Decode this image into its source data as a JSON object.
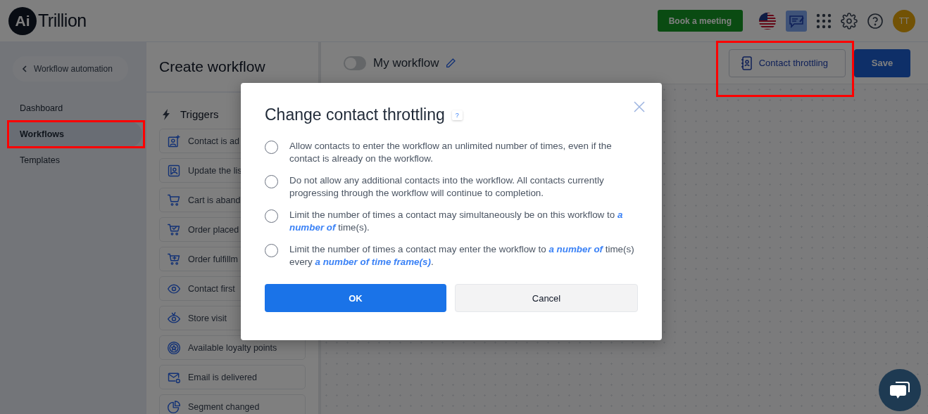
{
  "header": {
    "logo_mark": "Ai",
    "logo_text": "Trillion",
    "book_button": "Book a meeting",
    "avatar": "TT"
  },
  "sidebar": {
    "back_link": "Workflow automation",
    "items": [
      {
        "label": "Dashboard",
        "selected": false,
        "highlighted": false
      },
      {
        "label": "Workflows",
        "selected": true,
        "highlighted": true
      },
      {
        "label": "Templates",
        "selected": false,
        "highlighted": false
      }
    ]
  },
  "panel": {
    "title": "Create workflow",
    "section": "Triggers",
    "triggers": [
      {
        "label": "Contact is ad",
        "kind": "contact"
      },
      {
        "label": "Update the lis",
        "kind": "list"
      },
      {
        "label": "Cart is aband",
        "kind": "cart"
      },
      {
        "label": "Order placed",
        "kind": "order"
      },
      {
        "label": "Order fulfillm",
        "kind": "fulfillment"
      },
      {
        "label": "Contact first",
        "kind": "view"
      },
      {
        "label": "Store visit",
        "kind": "visit"
      },
      {
        "label": "Available loyalty points",
        "kind": "loyalty"
      },
      {
        "label": "Email is delivered",
        "kind": "email"
      },
      {
        "label": "Segment changed",
        "kind": "segment"
      }
    ]
  },
  "canvas": {
    "workflow_on": false,
    "workflow_name": "My workflow",
    "throttling_button": {
      "label": "Contact throttling",
      "highlighted": true
    },
    "save_button": "Save"
  },
  "dialog": {
    "title": "Change contact throttling",
    "help": "?",
    "options": [
      {
        "text": "Allow contacts to enter the workflow an unlimited number of times, even if the contact is already on the workflow.",
        "selected": false
      },
      {
        "text": "Do not allow any additional contacts into the workflow. All contacts currently progressing through the workflow will continue to completion.",
        "selected": false
      },
      {
        "text": "Limit the number of times a contact may simultaneously be on this workflow to *a number of* time(s).",
        "selected": false
      },
      {
        "text": "Limit the number of times a contact may enter the workflow to *a number of* time(s) every *a number of time frame(s)*.",
        "selected": false
      }
    ],
    "ok": "OK",
    "cancel": "Cancel"
  }
}
